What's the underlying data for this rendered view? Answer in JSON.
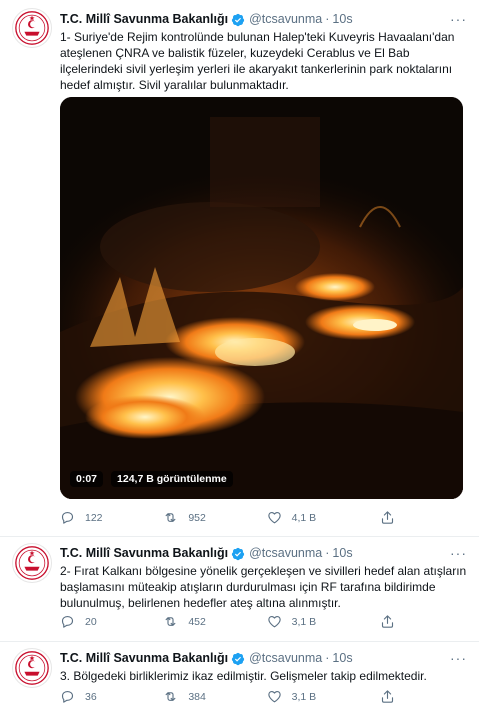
{
  "tweets": [
    {
      "name": "T.C. Millî Savunma Bakanlığı",
      "handle": "@tcsavunma",
      "sep": "·",
      "time": "10s",
      "text": "1- Suriye'de Rejim kontrolünde bulunan Halep'teki Kuveyris Havaalanı'dan ateşlenen ÇNRA ve balistik füzeler, kuzeydeki Cerablus ve El Bab ilçelerindeki sivil yerleşim yerleri ile akaryakıt tankerlerinin park noktalarını hedef almıştır. Sivil yaralılar bulunmaktadır.",
      "video": {
        "duration": "0:07",
        "views": "124,7 B görüntülenme"
      },
      "replies": "122",
      "retweets": "952",
      "likes": "4,1 B"
    },
    {
      "name": "T.C. Millî Savunma Bakanlığı",
      "handle": "@tcsavunma",
      "sep": "·",
      "time": "10s",
      "text": "2- Fırat Kalkanı bölgesine yönelik gerçekleşen ve sivilleri hedef alan atışların başlamasını müteakip atışların durdurulması için RF tarafına bildirimde bulunulmuş, belirlenen hedefler ateş altına alınmıştır.",
      "replies": "20",
      "retweets": "452",
      "likes": "3,1 B"
    },
    {
      "name": "T.C. Millî Savunma Bakanlığı",
      "handle": "@tcsavunma",
      "sep": "·",
      "time": "10s",
      "text": "3. Bölgedeki birliklerimiz ikaz edilmiştir. Gelişmeler takip edilmektedir.",
      "replies": "36",
      "retweets": "384",
      "likes": "3,1 B"
    }
  ],
  "colors": {
    "muted": "#5b7083",
    "verified": "#1da1f2",
    "logo_red": "#c8102e"
  },
  "icons": {
    "reply": "reply-icon",
    "retweet": "retweet-icon",
    "like": "like-icon",
    "share": "share-icon",
    "more": "more-icon",
    "verified": "verified-badge-icon"
  }
}
